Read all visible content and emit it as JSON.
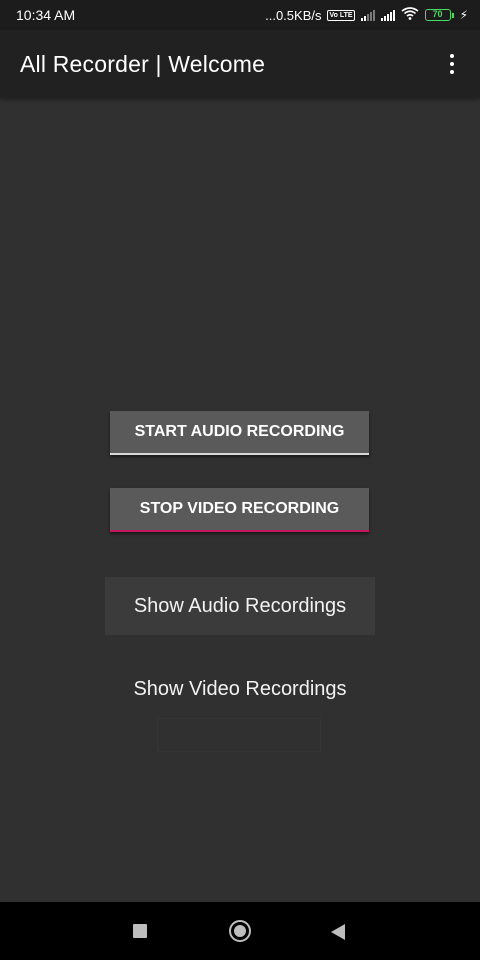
{
  "status_bar": {
    "time": "10:34 AM",
    "net_speed": "...0.5KB/s",
    "volte": "Vo LTE",
    "battery_level": "70"
  },
  "app_bar": {
    "title": "All Recorder | Welcome",
    "menu_icon": "more-vert-icon"
  },
  "main": {
    "start_audio_label": "START AUDIO RECORDING",
    "stop_video_label": "STOP VIDEO RECORDING",
    "show_audio_label": "Show Audio Recordings",
    "show_video_label": "Show Video Recordings"
  },
  "nav_bar": {
    "recents_icon": "square-icon",
    "home_icon": "circle-icon",
    "back_icon": "triangle-back-icon"
  },
  "colors": {
    "background": "#303030",
    "app_bar": "#212121",
    "button": "#5a5a5a",
    "stop_accent": "#c2185b",
    "battery": "#4cd964"
  }
}
